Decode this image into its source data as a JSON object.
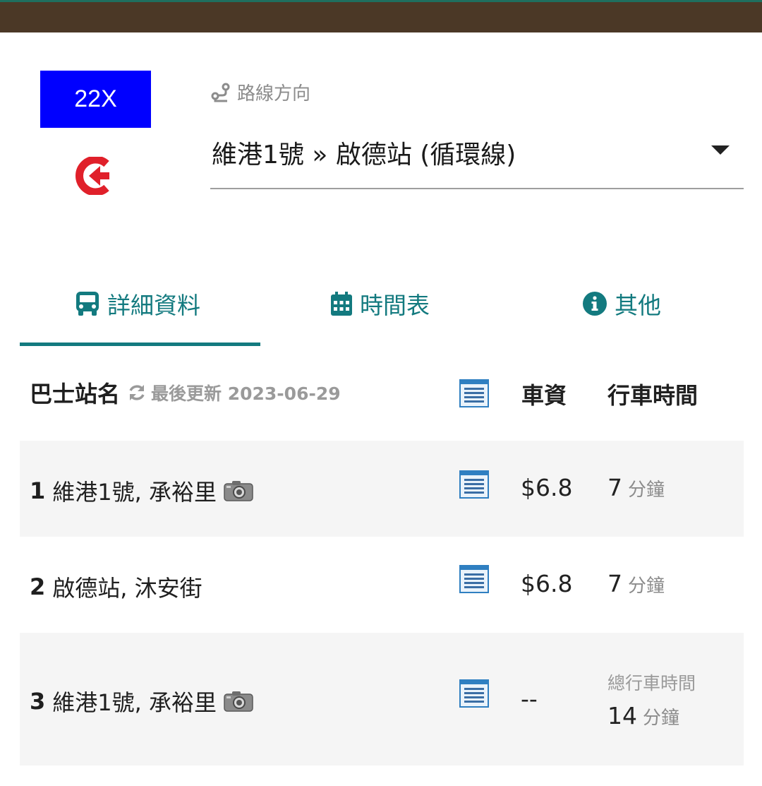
{
  "route": {
    "number": "22X",
    "badge_color": "#0000ff",
    "circular_icon": "circular-route-icon"
  },
  "direction": {
    "label": "路線方向",
    "selected": "維港1號 » 啟德站 (循環線)"
  },
  "tabs": [
    {
      "label": "詳細資料",
      "icon": "bus-icon",
      "active": true
    },
    {
      "label": "時間表",
      "icon": "calendar-icon",
      "active": false
    },
    {
      "label": "其他",
      "icon": "info-icon",
      "active": false
    }
  ],
  "table": {
    "headers": {
      "stop_name": "巴士站名",
      "last_updated": "最後更新 2023-06-29",
      "fare": "車資",
      "travel_time": "行車時間"
    },
    "rows": [
      {
        "num": "1",
        "name": "維港1號, 承裕里",
        "has_photo": true,
        "fare": "$6.8",
        "time": "7",
        "unit": "分鐘"
      },
      {
        "num": "2",
        "name": "啟德站, 沐安街",
        "has_photo": false,
        "fare": "$6.8",
        "time": "7",
        "unit": "分鐘"
      },
      {
        "num": "3",
        "name": "維港1號, 承裕里",
        "has_photo": true,
        "fare": "--",
        "total_label": "總行車時間",
        "time": "14",
        "unit": "分鐘"
      }
    ]
  },
  "colors": {
    "accent": "#137a7f",
    "top_bar": "#4b3826"
  }
}
